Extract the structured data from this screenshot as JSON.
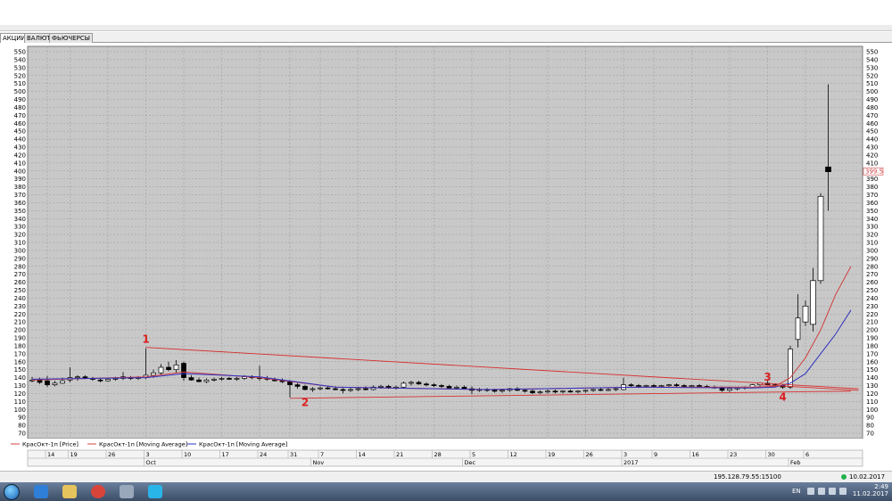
{
  "tabs": [
    {
      "label": "АКЦИИ",
      "active": true
    },
    {
      "label": "ВАЛЮТА",
      "active": false
    },
    {
      "label": "ФЬЮЧЕРСЫ",
      "active": false
    }
  ],
  "chart_data": {
    "type": "candlestick",
    "ylim": [
      70,
      550
    ],
    "y_ticks": [
      70,
      80,
      90,
      100,
      110,
      120,
      130,
      140,
      150,
      160,
      170,
      180,
      190,
      200,
      210,
      220,
      230,
      240,
      250,
      260,
      270,
      280,
      290,
      300,
      310,
      320,
      330,
      340,
      350,
      360,
      370,
      380,
      390,
      400,
      410,
      420,
      430,
      440,
      450,
      460,
      470,
      480,
      490,
      500,
      510,
      520,
      530,
      540,
      550
    ],
    "last_price_label": "399.5",
    "legend": [
      {
        "name": "КрасОкт-1п [Price]",
        "color": "#d04040"
      },
      {
        "name": "КрасОкт-1п [Moving Average]",
        "color": "#d04040"
      },
      {
        "name": "КрасОкт-1п [Moving Average]",
        "color": "#3030c0"
      }
    ],
    "x_day_ticks": [
      {
        "label": "14",
        "i": 2
      },
      {
        "label": "19",
        "i": 5
      },
      {
        "label": "26",
        "i": 10
      },
      {
        "label": "3",
        "i": 15
      },
      {
        "label": "10",
        "i": 20
      },
      {
        "label": "17",
        "i": 25
      },
      {
        "label": "24",
        "i": 30
      },
      {
        "label": "31",
        "i": 34
      },
      {
        "label": "7",
        "i": 38
      },
      {
        "label": "14",
        "i": 43
      },
      {
        "label": "21",
        "i": 48
      },
      {
        "label": "28",
        "i": 53
      },
      {
        "label": "5",
        "i": 58
      },
      {
        "label": "12",
        "i": 63
      },
      {
        "label": "19",
        "i": 68
      },
      {
        "label": "26",
        "i": 73
      },
      {
        "label": "3",
        "i": 78
      },
      {
        "label": "9",
        "i": 82
      },
      {
        "label": "16",
        "i": 87
      },
      {
        "label": "23",
        "i": 92
      },
      {
        "label": "30",
        "i": 97
      },
      {
        "label": "6",
        "i": 102
      }
    ],
    "x_month_ticks": [
      {
        "label": "Oct",
        "i": 15
      },
      {
        "label": "Nov",
        "i": 37
      },
      {
        "label": "Dec",
        "i": 57
      },
      {
        "label": "2017",
        "i": 78
      },
      {
        "label": "Feb",
        "i": 100
      }
    ],
    "candles": [
      {
        "o": 136,
        "h": 141,
        "l": 134,
        "c": 137
      },
      {
        "o": 137,
        "h": 140,
        "l": 132,
        "c": 134
      },
      {
        "o": 136,
        "h": 142,
        "l": 128,
        "c": 131
      },
      {
        "o": 131,
        "h": 136,
        "l": 129,
        "c": 133
      },
      {
        "o": 133,
        "h": 140,
        "l": 132,
        "c": 136
      },
      {
        "o": 137,
        "h": 153,
        "l": 134,
        "c": 140
      },
      {
        "o": 140,
        "h": 143,
        "l": 136,
        "c": 141
      },
      {
        "o": 141,
        "h": 143,
        "l": 138,
        "c": 139
      },
      {
        "o": 139,
        "h": 141,
        "l": 136,
        "c": 138
      },
      {
        "o": 137,
        "h": 140,
        "l": 134,
        "c": 136
      },
      {
        "o": 136,
        "h": 140,
        "l": 135,
        "c": 138
      },
      {
        "o": 138,
        "h": 141,
        "l": 136,
        "c": 139
      },
      {
        "o": 139,
        "h": 147,
        "l": 137,
        "c": 141
      },
      {
        "o": 140,
        "h": 142,
        "l": 137,
        "c": 139
      },
      {
        "o": 139,
        "h": 142,
        "l": 137,
        "c": 140
      },
      {
        "o": 140,
        "h": 177,
        "l": 138,
        "c": 143
      },
      {
        "o": 143,
        "h": 150,
        "l": 140,
        "c": 146
      },
      {
        "o": 146,
        "h": 157,
        "l": 143,
        "c": 153
      },
      {
        "o": 153,
        "h": 160,
        "l": 148,
        "c": 150
      },
      {
        "o": 150,
        "h": 162,
        "l": 146,
        "c": 156
      },
      {
        "o": 158,
        "h": 160,
        "l": 136,
        "c": 140
      },
      {
        "o": 140,
        "h": 143,
        "l": 136,
        "c": 137
      },
      {
        "o": 137,
        "h": 140,
        "l": 134,
        "c": 135
      },
      {
        "o": 135,
        "h": 139,
        "l": 133,
        "c": 137
      },
      {
        "o": 137,
        "h": 140,
        "l": 135,
        "c": 138
      },
      {
        "o": 138,
        "h": 141,
        "l": 136,
        "c": 139
      },
      {
        "o": 139,
        "h": 141,
        "l": 137,
        "c": 138
      },
      {
        "o": 138,
        "h": 141,
        "l": 136,
        "c": 139
      },
      {
        "o": 139,
        "h": 143,
        "l": 137,
        "c": 141
      },
      {
        "o": 141,
        "h": 143,
        "l": 138,
        "c": 140
      },
      {
        "o": 140,
        "h": 155,
        "l": 136,
        "c": 139
      },
      {
        "o": 139,
        "h": 142,
        "l": 136,
        "c": 138
      },
      {
        "o": 138,
        "h": 140,
        "l": 135,
        "c": 136
      },
      {
        "o": 136,
        "h": 139,
        "l": 133,
        "c": 135
      },
      {
        "o": 135,
        "h": 137,
        "l": 115,
        "c": 131
      },
      {
        "o": 131,
        "h": 133,
        "l": 126,
        "c": 129
      },
      {
        "o": 129,
        "h": 131,
        "l": 124,
        "c": 125
      },
      {
        "o": 125,
        "h": 128,
        "l": 122,
        "c": 126
      },
      {
        "o": 126,
        "h": 129,
        "l": 124,
        "c": 127
      },
      {
        "o": 127,
        "h": 130,
        "l": 125,
        "c": 126
      },
      {
        "o": 126,
        "h": 129,
        "l": 124,
        "c": 125
      },
      {
        "o": 125,
        "h": 127,
        "l": 120,
        "c": 124
      },
      {
        "o": 124,
        "h": 127,
        "l": 122,
        "c": 125
      },
      {
        "o": 125,
        "h": 128,
        "l": 123,
        "c": 126
      },
      {
        "o": 126,
        "h": 129,
        "l": 124,
        "c": 125
      },
      {
        "o": 125,
        "h": 130,
        "l": 124,
        "c": 128
      },
      {
        "o": 128,
        "h": 131,
        "l": 126,
        "c": 129
      },
      {
        "o": 129,
        "h": 131,
        "l": 126,
        "c": 127
      },
      {
        "o": 127,
        "h": 130,
        "l": 125,
        "c": 128
      },
      {
        "o": 128,
        "h": 135,
        "l": 127,
        "c": 133
      },
      {
        "o": 133,
        "h": 136,
        "l": 130,
        "c": 134
      },
      {
        "o": 134,
        "h": 136,
        "l": 131,
        "c": 132
      },
      {
        "o": 132,
        "h": 134,
        "l": 129,
        "c": 131
      },
      {
        "o": 131,
        "h": 133,
        "l": 128,
        "c": 130
      },
      {
        "o": 130,
        "h": 132,
        "l": 127,
        "c": 129
      },
      {
        "o": 129,
        "h": 131,
        "l": 126,
        "c": 127
      },
      {
        "o": 127,
        "h": 130,
        "l": 125,
        "c": 128
      },
      {
        "o": 128,
        "h": 130,
        "l": 125,
        "c": 126
      },
      {
        "o": 126,
        "h": 129,
        "l": 119,
        "c": 124
      },
      {
        "o": 124,
        "h": 127,
        "l": 122,
        "c": 125
      },
      {
        "o": 125,
        "h": 127,
        "l": 122,
        "c": 124
      },
      {
        "o": 124,
        "h": 126,
        "l": 121,
        "c": 123
      },
      {
        "o": 123,
        "h": 126,
        "l": 121,
        "c": 124
      },
      {
        "o": 124,
        "h": 127,
        "l": 122,
        "c": 126
      },
      {
        "o": 126,
        "h": 128,
        "l": 123,
        "c": 124
      },
      {
        "o": 124,
        "h": 126,
        "l": 121,
        "c": 123
      },
      {
        "o": 123,
        "h": 125,
        "l": 119,
        "c": 121
      },
      {
        "o": 121,
        "h": 124,
        "l": 119,
        "c": 122
      },
      {
        "o": 122,
        "h": 125,
        "l": 120,
        "c": 123
      },
      {
        "o": 123,
        "h": 125,
        "l": 120,
        "c": 122
      },
      {
        "o": 122,
        "h": 124,
        "l": 120,
        "c": 123
      },
      {
        "o": 123,
        "h": 125,
        "l": 121,
        "c": 122
      },
      {
        "o": 122,
        "h": 124,
        "l": 120,
        "c": 123
      },
      {
        "o": 123,
        "h": 125,
        "l": 121,
        "c": 124
      },
      {
        "o": 124,
        "h": 126,
        "l": 122,
        "c": 125
      },
      {
        "o": 125,
        "h": 127,
        "l": 123,
        "c": 124
      },
      {
        "o": 124,
        "h": 127,
        "l": 123,
        "c": 125
      },
      {
        "o": 125,
        "h": 128,
        "l": 123,
        "c": 126
      },
      {
        "o": 125,
        "h": 140,
        "l": 124,
        "c": 131
      },
      {
        "o": 131,
        "h": 133,
        "l": 128,
        "c": 130
      },
      {
        "o": 130,
        "h": 132,
        "l": 127,
        "c": 129
      },
      {
        "o": 129,
        "h": 131,
        "l": 127,
        "c": 130
      },
      {
        "o": 130,
        "h": 132,
        "l": 128,
        "c": 129
      },
      {
        "o": 129,
        "h": 131,
        "l": 127,
        "c": 130
      },
      {
        "o": 130,
        "h": 132,
        "l": 128,
        "c": 131
      },
      {
        "o": 131,
        "h": 133,
        "l": 128,
        "c": 130
      },
      {
        "o": 130,
        "h": 132,
        "l": 128,
        "c": 129
      },
      {
        "o": 129,
        "h": 131,
        "l": 127,
        "c": 130
      },
      {
        "o": 130,
        "h": 132,
        "l": 128,
        "c": 129
      },
      {
        "o": 129,
        "h": 131,
        "l": 127,
        "c": 128
      },
      {
        "o": 128,
        "h": 130,
        "l": 126,
        "c": 127
      },
      {
        "o": 127,
        "h": 129,
        "l": 122,
        "c": 124
      },
      {
        "o": 124,
        "h": 127,
        "l": 122,
        "c": 126
      },
      {
        "o": 126,
        "h": 128,
        "l": 124,
        "c": 127
      },
      {
        "o": 127,
        "h": 129,
        "l": 125,
        "c": 128
      },
      {
        "o": 128,
        "h": 132,
        "l": 127,
        "c": 131
      },
      {
        "o": 131,
        "h": 134,
        "l": 129,
        "c": 133
      },
      {
        "o": 133,
        "h": 136,
        "l": 130,
        "c": 131
      },
      {
        "o": 131,
        "h": 133,
        "l": 128,
        "c": 130
      },
      {
        "o": 130,
        "h": 132,
        "l": 126,
        "c": 128
      },
      {
        "o": 128,
        "h": 180,
        "l": 126,
        "c": 176
      },
      {
        "o": 188,
        "h": 245,
        "l": 178,
        "c": 215
      },
      {
        "o": 210,
        "h": 237,
        "l": 205,
        "c": 230
      },
      {
        "o": 207,
        "h": 278,
        "l": 198,
        "c": 262
      },
      {
        "o": 262,
        "h": 372,
        "l": 258,
        "c": 368
      },
      {
        "o": 405,
        "h": 509,
        "l": 350,
        "c": 399
      }
    ],
    "ma_red": [
      [
        0,
        137
      ],
      [
        15,
        141
      ],
      [
        20,
        147
      ],
      [
        30,
        140
      ],
      [
        40,
        128
      ],
      [
        60,
        125
      ],
      [
        80,
        128
      ],
      [
        95,
        128
      ],
      [
        98,
        129
      ],
      [
        100,
        140
      ],
      [
        102,
        165
      ],
      [
        104,
        200
      ],
      [
        106,
        245
      ],
      [
        108,
        280
      ]
    ],
    "ma_blue": [
      [
        0,
        138
      ],
      [
        15,
        140
      ],
      [
        20,
        145
      ],
      [
        30,
        141
      ],
      [
        40,
        128
      ],
      [
        60,
        125
      ],
      [
        80,
        128
      ],
      [
        95,
        127
      ],
      [
        98,
        128
      ],
      [
        100,
        133
      ],
      [
        102,
        145
      ],
      [
        104,
        170
      ],
      [
        106,
        195
      ],
      [
        108,
        225
      ]
    ],
    "trendlines": [
      {
        "from": [
          15,
          178
        ],
        "to": [
          109,
          126
        ]
      },
      {
        "from": [
          34,
          114
        ],
        "to": [
          108,
          123
        ]
      },
      {
        "from": [
          96,
          131
        ],
        "to": [
          109,
          124
        ]
      }
    ],
    "annotations": [
      {
        "text": "1",
        "at": [
          15,
          184
        ]
      },
      {
        "text": "2",
        "at": [
          36,
          104
        ]
      },
      {
        "text": "3",
        "at": [
          97,
          136
        ]
      },
      {
        "text": "4",
        "at": [
          99,
          111
        ]
      }
    ]
  },
  "status": {
    "server": "195.128.79.55:15100",
    "date": "10.02.2017"
  },
  "taskbar": {
    "lang": "EN",
    "time": "2:49",
    "date": "11.02.2017"
  }
}
